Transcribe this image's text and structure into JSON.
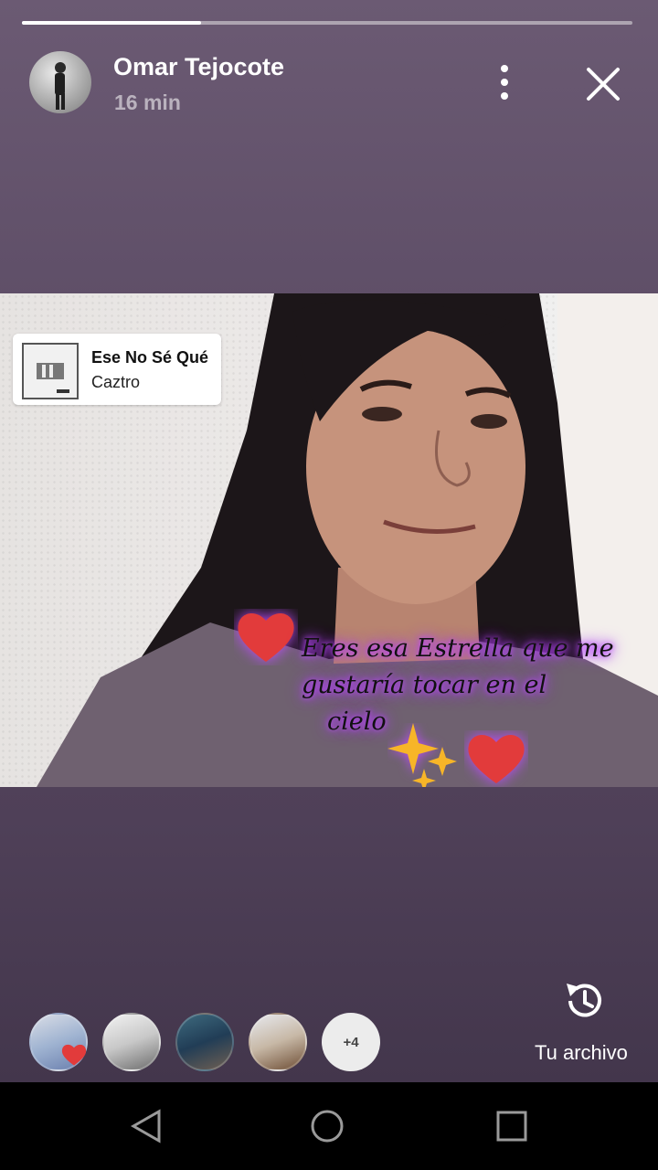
{
  "story": {
    "progress_fraction": 0.294,
    "author": "Omar Tejocote",
    "time": "16 min"
  },
  "music": {
    "title": "Ese No Sé Qué",
    "artist": "Caztro"
  },
  "caption": {
    "line1": "Eres esa Estrella que me",
    "line2": "gustaría tocar en el",
    "line3": "cielo"
  },
  "viewers": {
    "more_count": "+4"
  },
  "archive": {
    "label": "Tu archivo"
  },
  "colors": {
    "background_top": "#6b5a73",
    "background_bottom": "#3f3348",
    "caption_glow": "#b040ff",
    "heart": "#e23b3b"
  }
}
